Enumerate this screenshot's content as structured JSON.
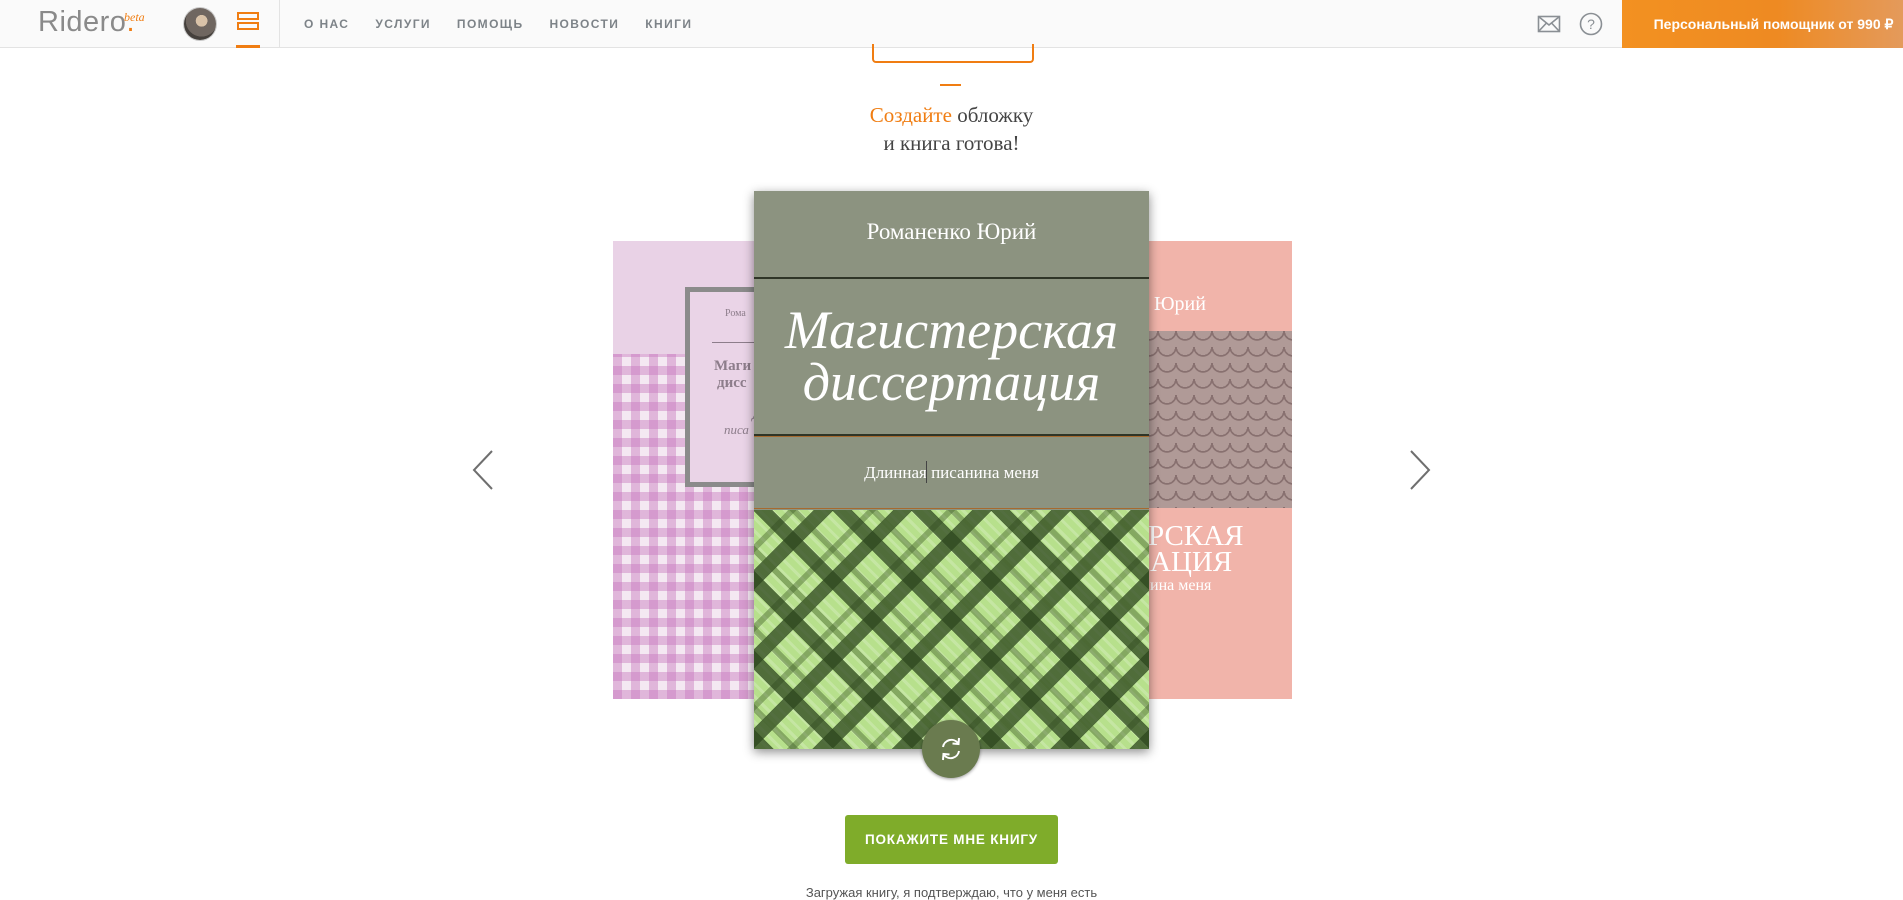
{
  "header": {
    "logo": "Ridero",
    "logo_dot": ".",
    "logo_badge": "beta",
    "nav": [
      "О НАС",
      "УСЛУГИ",
      "ПОМОЩЬ",
      "НОВОСТИ",
      "КНИГИ"
    ],
    "promo": "Персональный помощник от 990 ₽",
    "icons": [
      "avatar",
      "menu-icon",
      "mail-icon",
      "help-icon"
    ]
  },
  "headline": {
    "accent": "Создайте",
    "line1_rest": " обложку",
    "line2": "и книга готова!"
  },
  "main_book": {
    "author": "Романенко Юрий",
    "title_line1": "Магистерская",
    "title_line2": "диссертация",
    "subtitle": "Длинная писанина меня"
  },
  "left_book": {
    "author": "Рома",
    "title_line1": "Маги",
    "title_line2": "дисс",
    "subtitle_line1": "Д",
    "subtitle_line2": "писа"
  },
  "right_book": {
    "author": "Юрий",
    "title_line1": "РСКАЯ",
    "title_line2": "АЦИЯ",
    "subtitle": "ина меня"
  },
  "actions": {
    "show_book": "ПОКАЖИТЕ МНЕ КНИГУ"
  },
  "footer_text": "Загружая книгу, я подтверждаю, что у меня есть",
  "colors": {
    "accent": "#f07d12",
    "button_green": "#7fac2a",
    "cover_main": "#8c9380"
  }
}
